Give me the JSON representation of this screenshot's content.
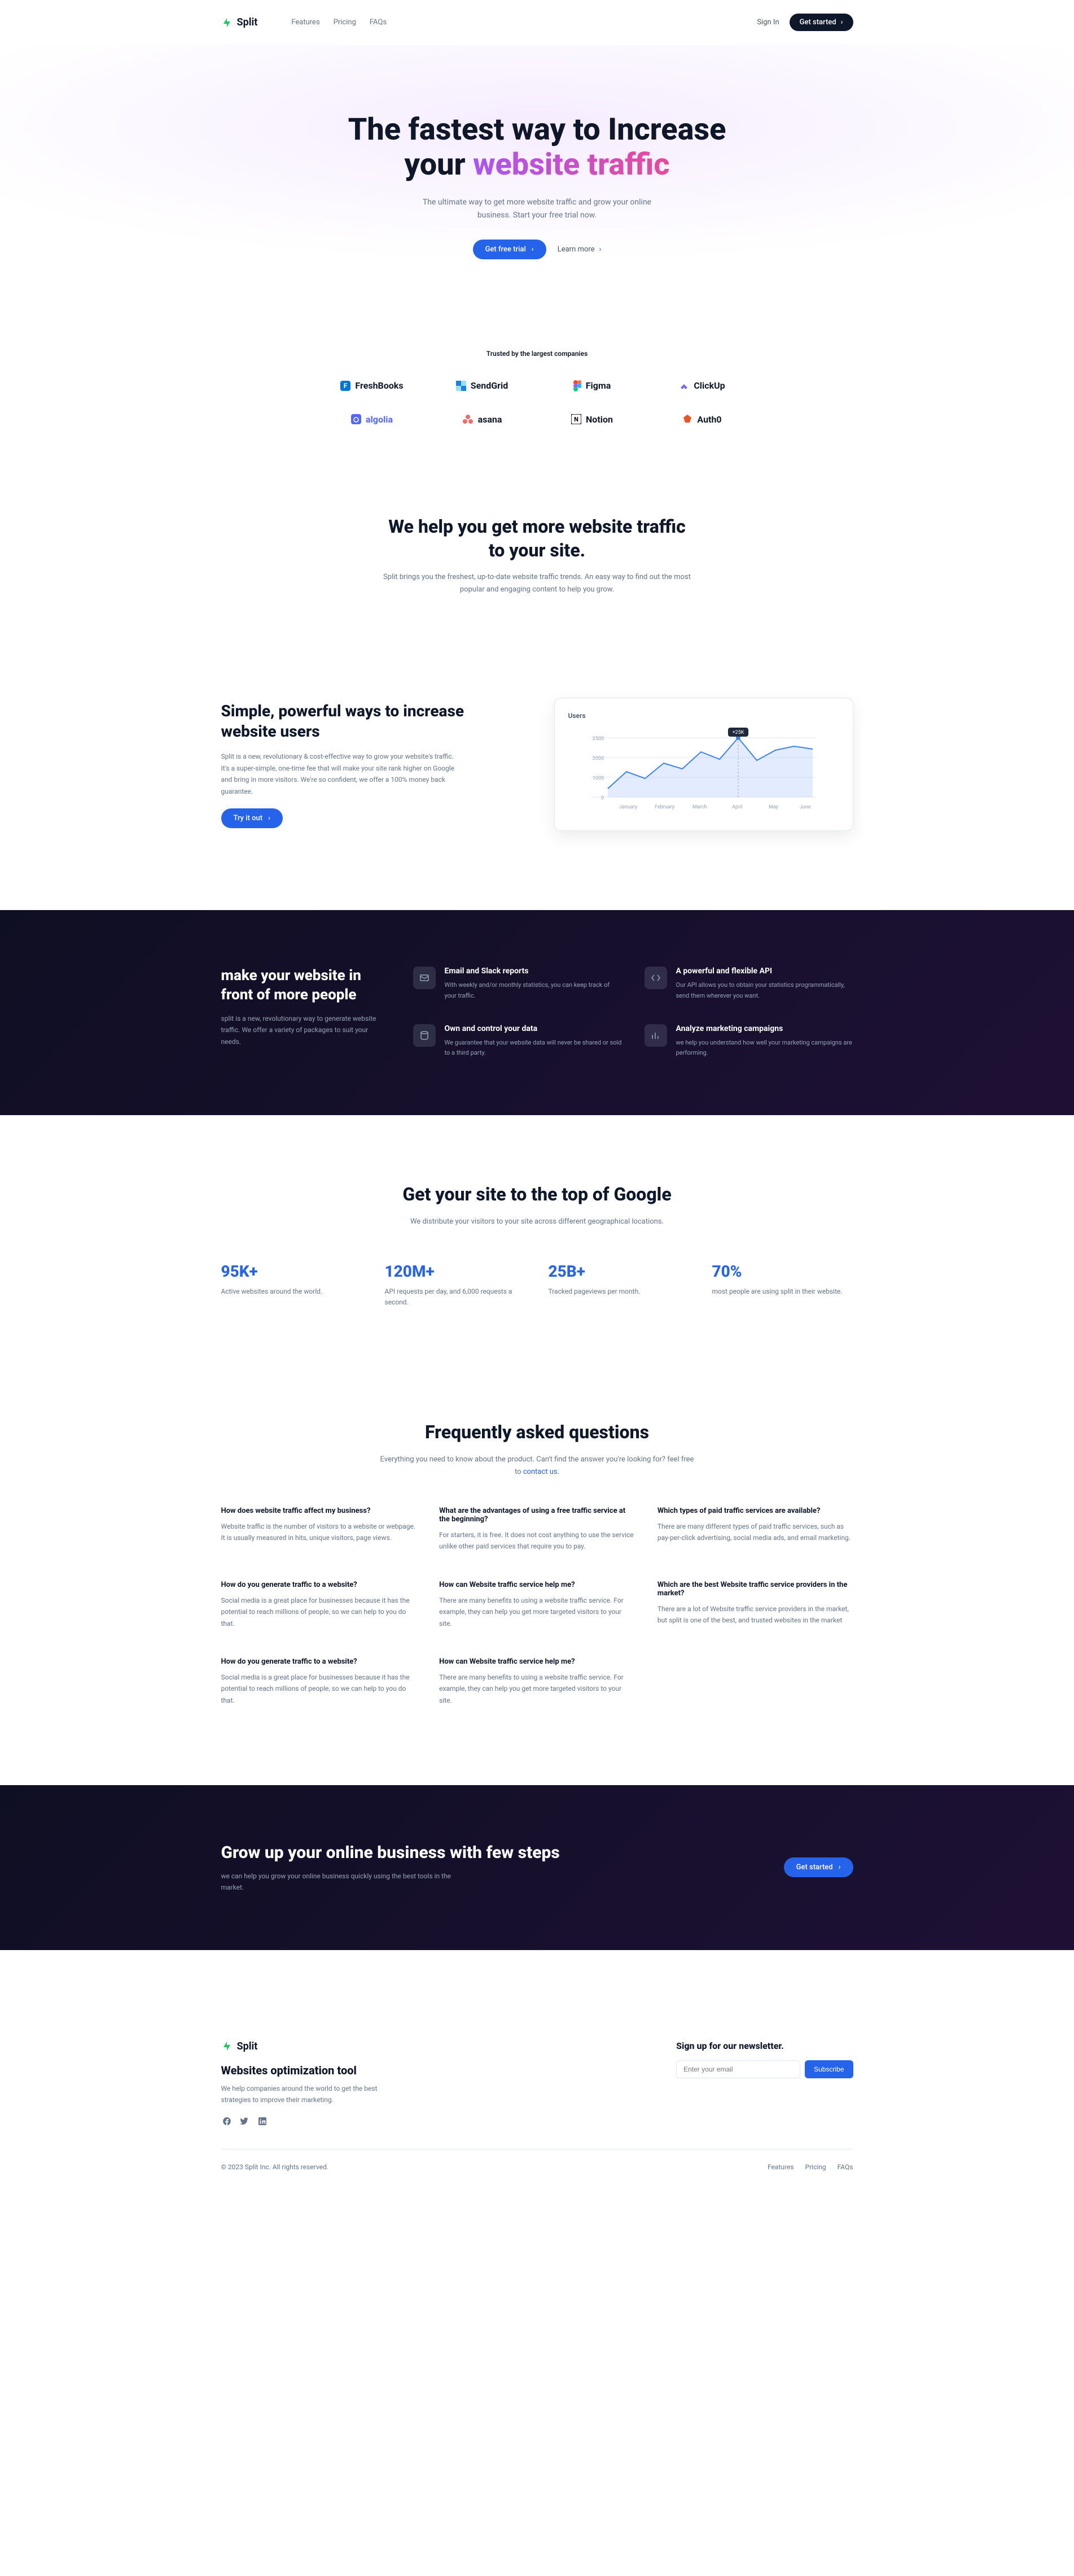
{
  "header": {
    "brand": "Split",
    "nav": [
      "Features",
      "Pricing",
      "FAQs"
    ],
    "signin": "Sign In",
    "cta": "Get started"
  },
  "hero": {
    "line1": "The fastest way to Increase",
    "line2a": "your ",
    "line2b": "website traffic",
    "sub": "The ultimate way to get more website traffic and grow your online business. Start your free trial now.",
    "primary": "Get free trial",
    "secondary": "Learn more"
  },
  "trusted": {
    "label": "Trusted by the largest companies",
    "logos": [
      "FreshBooks",
      "SendGrid",
      "Figma",
      "ClickUp",
      "algolia",
      "asana",
      "Notion",
      "Auth0"
    ]
  },
  "help": {
    "title": "We help you get more website traffic to your site.",
    "sub": "Split brings you the freshest, up-to-date website traffic trends. An easy way to find out the most popular and engaging content to help you grow."
  },
  "feature": {
    "title": "Simple, powerful ways to increase website users",
    "sub": "Split is a new, revolutionary & cost-effective way to grow your website's traffic. It's a super-simple, one-time fee that will make your site rank higher on Google and bring in more visitors. We're so confident, we offer a 100% money back guarantee.",
    "cta": "Try it out",
    "chartTitle": "Users",
    "chartBadge": "+25K"
  },
  "dark": {
    "title": "make your website in front of more people",
    "sub": "split is a new, revolutionary way to generate website traffic. We offer a variety of packages to suit your needs.",
    "items": [
      {
        "title": "Email and Slack reports",
        "desc": "With weekly and/or monthly statistics, you can keep track of your traffic."
      },
      {
        "title": "A powerful and flexible API",
        "desc": "Our API allows you to obtain your statistics programmatically, send them wherever you want."
      },
      {
        "title": "Own and control your data",
        "desc": "We guarantee that your website data will never be shared or sold to a third party."
      },
      {
        "title": "Analyze marketing campaigns",
        "desc": "we help you understand how well your marketing campaigns are performing."
      }
    ]
  },
  "stats": {
    "title": "Get your site to the top of Google",
    "sub": "We distribute your visitors to your site across different geographical locations.",
    "items": [
      {
        "num": "95K+",
        "label": "Active websites around the world."
      },
      {
        "num": "120M+",
        "label": "API requests per day, and 6,000 requests a second."
      },
      {
        "num": "25B+",
        "label": "Tracked pageviews per month."
      },
      {
        "num": "70%",
        "label": "most people are using split in their website."
      }
    ]
  },
  "faq": {
    "title": "Frequently asked questions",
    "sub1": "Everything you need to know about the product. Can't find the answer you're looking for? feel free to ",
    "link": "contact us",
    "items": [
      {
        "q": "How does website traffic affect my business?",
        "a": "Website traffic is the number of visitors to a website or webpage. It is usually measured in hits, unique visitors, page views."
      },
      {
        "q": "What are the advantages of using a free traffic service at the beginning?",
        "a": "For starters, it is free. It does not cost anything to use the service unlike other paid services that require you to pay."
      },
      {
        "q": "Which types of paid traffic services are available?",
        "a": "There are many different types of paid traffic services, such as pay-per-click advertising, social media ads, and email marketing."
      },
      {
        "q": "How do you generate traffic to a website?",
        "a": "Social media is a great place for businesses because it has the potential to reach millions of people, so we can help to you do that."
      },
      {
        "q": "How can Website traffic service help me?",
        "a": "There are many benefits to using a website traffic service. For example, they can help you get more targeted visitors to your site."
      },
      {
        "q": "Which are the best Website traffic service providers in the market?",
        "a": "There are a lot of Website traffic service providers in the market, but split is one of the best, and trusted websites in the market"
      },
      {
        "q": "How do you generate traffic to a website?",
        "a": "Social media is a great place for businesses because it has the potential to reach millions of people, so we can help to you do that."
      },
      {
        "q": "How can Website traffic service help me?",
        "a": "There are many benefits to using a website traffic service. For example, they can help you get more targeted visitors to your site."
      }
    ]
  },
  "cta": {
    "title": "Grow up your online business with few steps",
    "sub": "we can help you grow your online business quickly using the best tools in the market.",
    "button": "Get started"
  },
  "footer": {
    "brand": "Split",
    "title": "Websites optimization tool",
    "sub": "We help companies around the world to get the best strategies to improve their marketing.",
    "newsletterTitle": "Sign up for our newsletter.",
    "placeholder": "Enter your email",
    "subscribe": "Subscribe",
    "copyright": "© 2023 Split Inc. All rights reserved.",
    "nav": [
      "Features",
      "Pricing",
      "FAQs"
    ]
  },
  "chart_data": {
    "type": "line",
    "title": "Users",
    "x": [
      "January",
      "February",
      "March",
      "April",
      "May",
      "June"
    ],
    "y_ticks": [
      0,
      1000,
      2000,
      2500
    ],
    "values": [
      800,
      1400,
      1200,
      1800,
      1600,
      2300,
      2000,
      2500,
      1800,
      2200,
      2400,
      2300
    ],
    "badge": "+25K",
    "ylim": [
      0,
      2500
    ]
  }
}
